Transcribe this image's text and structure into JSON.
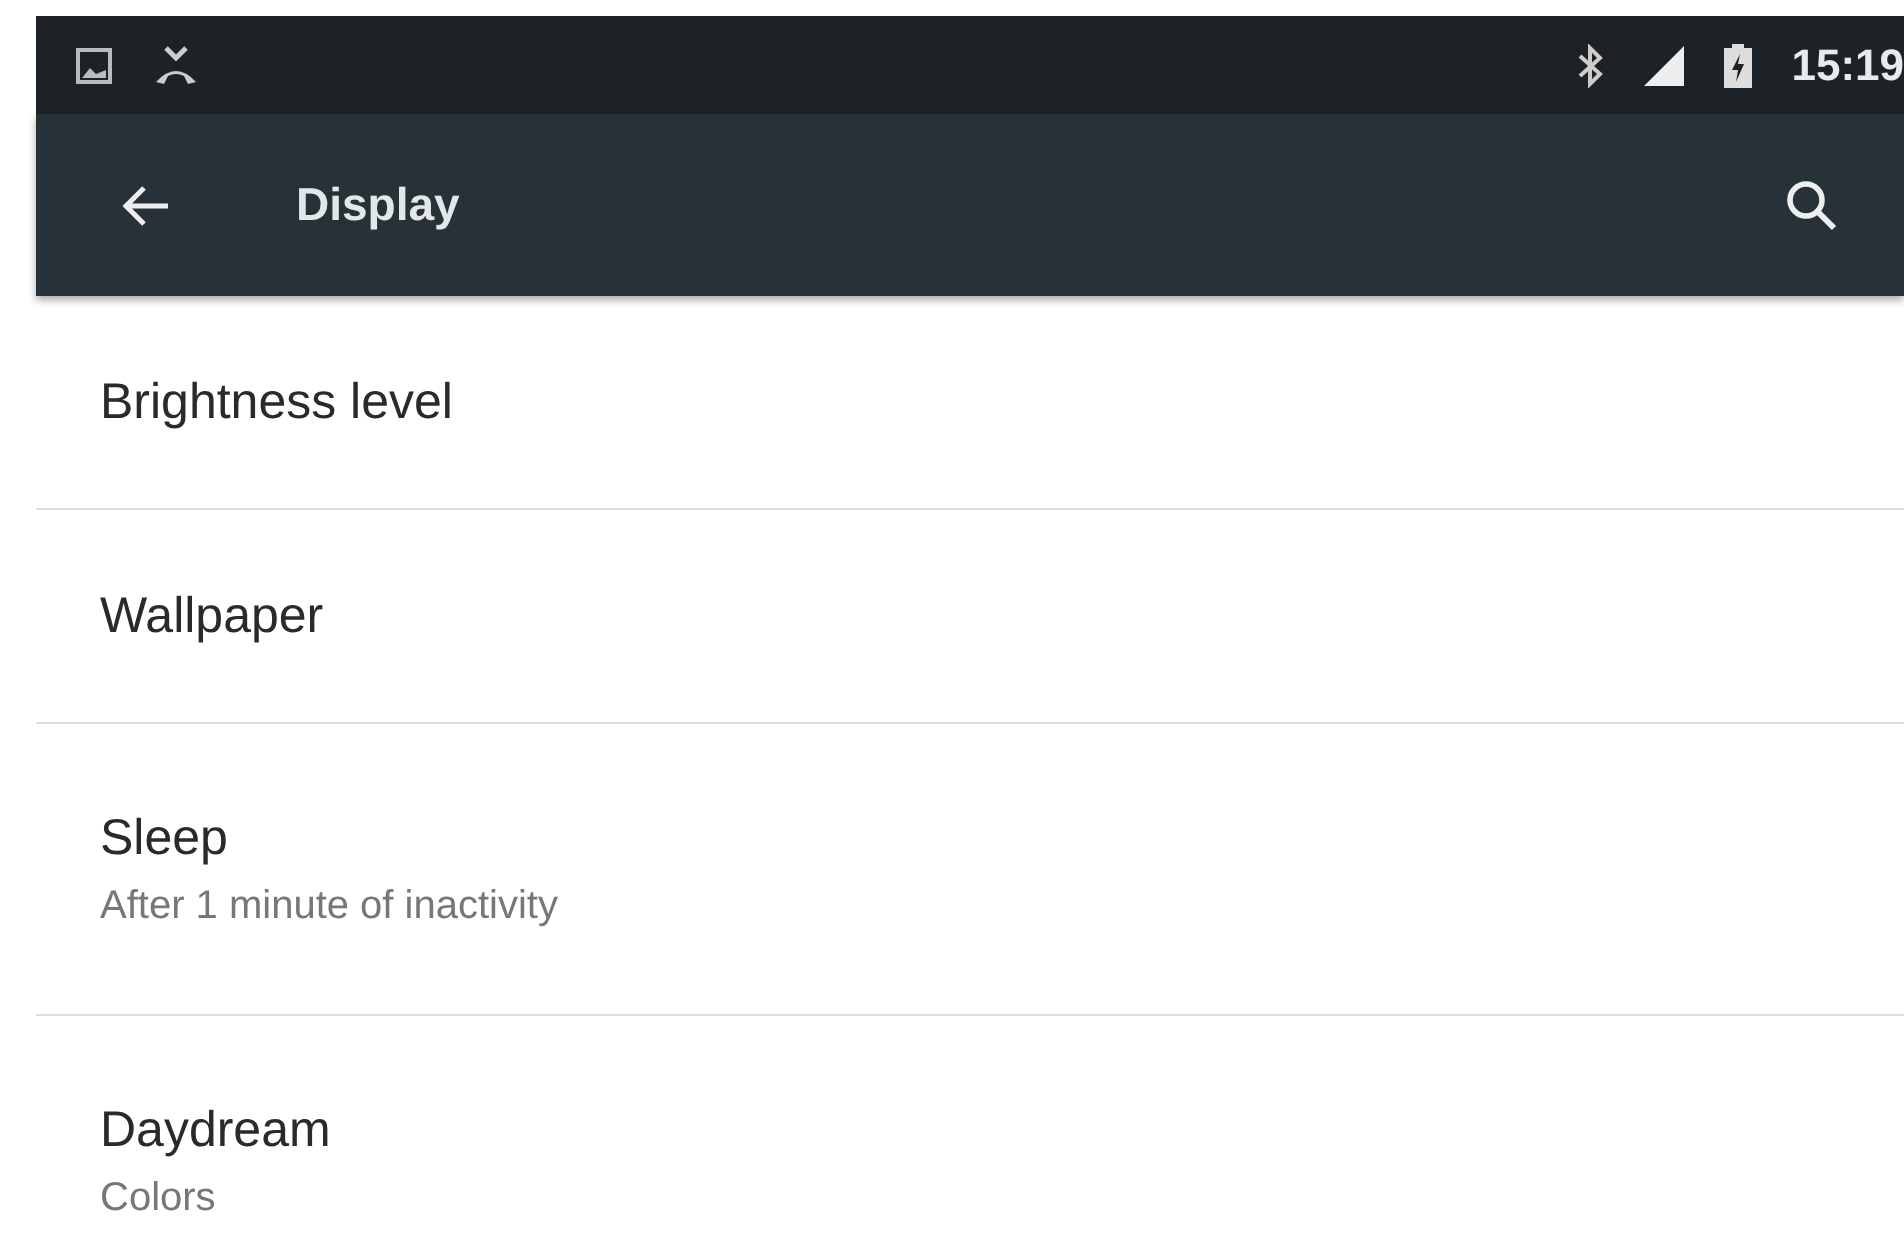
{
  "status_bar": {
    "time": "15:19"
  },
  "toolbar": {
    "title": "Display"
  },
  "items": [
    {
      "title": "Brightness level"
    },
    {
      "title": "Wallpaper"
    },
    {
      "title": "Sleep",
      "summary": "After 1 minute of inactivity"
    },
    {
      "title": "Daydream",
      "summary": "Colors"
    }
  ]
}
